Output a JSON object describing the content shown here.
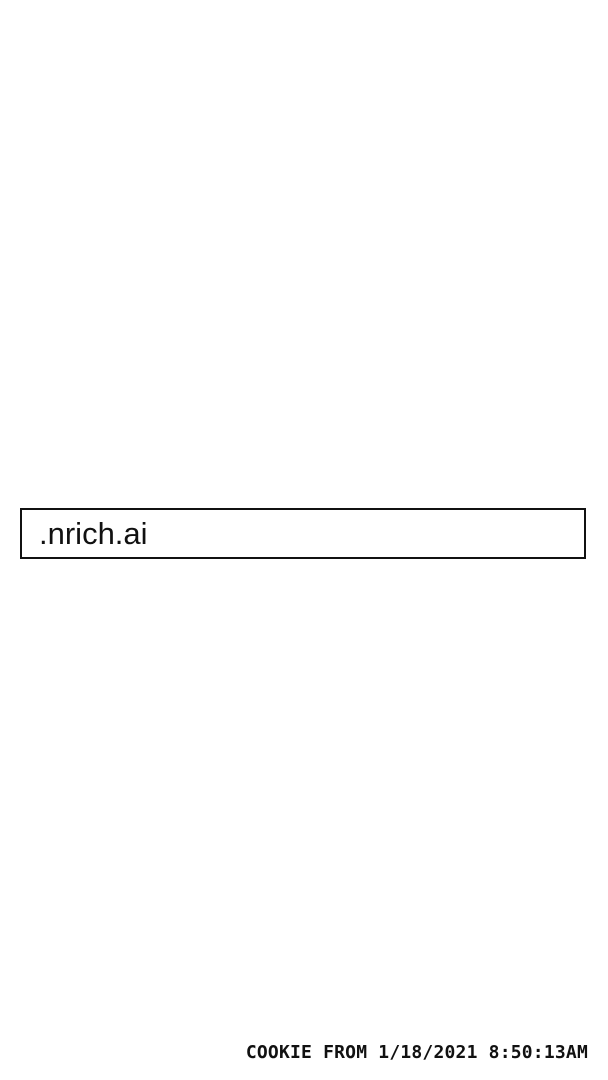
{
  "domain_box": {
    "text": ".nrich.ai"
  },
  "footer": {
    "cookie_label": "COOKIE FROM 1/18/2021 8:50:13AM"
  },
  "colors": {
    "background": "#ffffff",
    "text": "#111111",
    "border": "#111111"
  }
}
